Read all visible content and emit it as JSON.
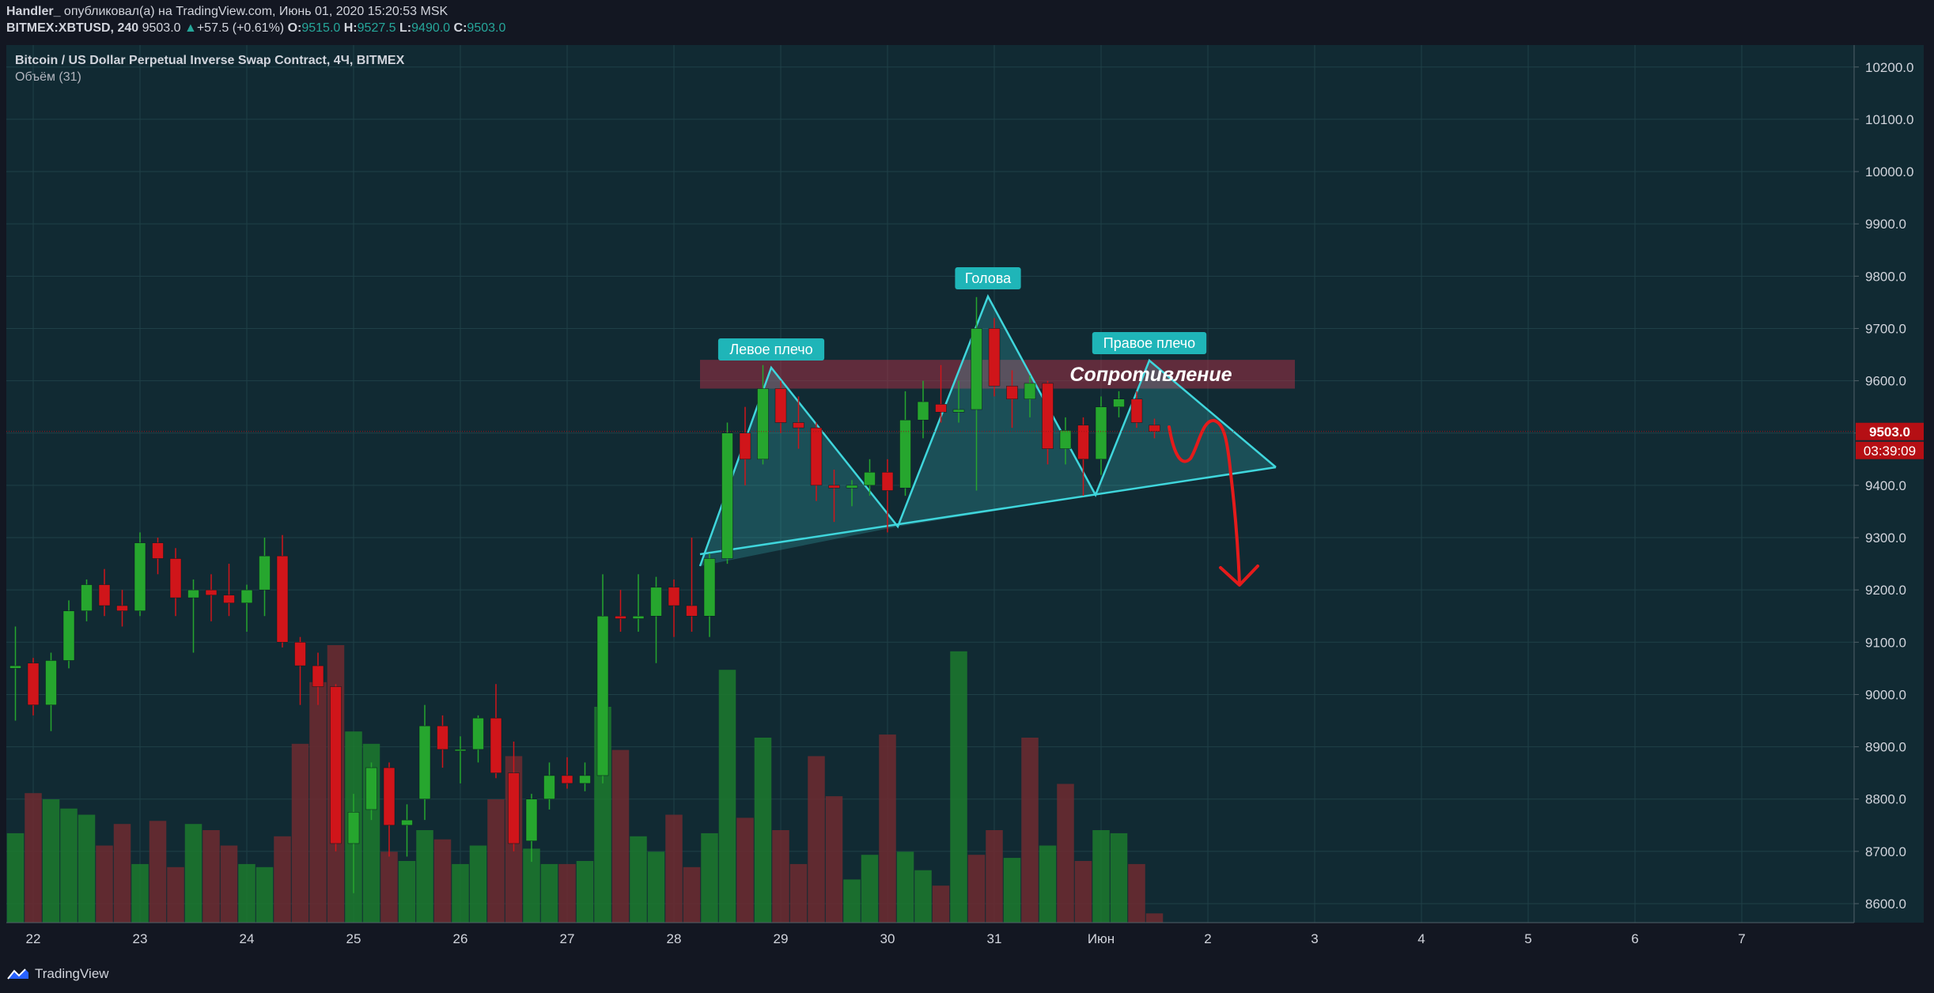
{
  "header": {
    "author": "Handler_",
    "published": " опубликовал(а) на TradingView.com, Июнь 01, 2020 15:20:53 MSK",
    "symbol": "BITMEX:XBTUSD, 240",
    "last": "9503.0",
    "change_arrow": "▲",
    "change": "+57.5 (+0.61%)",
    "o_label": "O:",
    "o": "9515.0",
    "h_label": "H:",
    "h": "9527.5",
    "l_label": "L:",
    "l": "9490.0",
    "c_label": "C:",
    "c": "9503.0"
  },
  "legend": {
    "title": "Bitcoin / US Dollar Perpetual Inverse Swap Contract, 4Ч, BITMEX",
    "volume": "Объём (31)"
  },
  "footer": {
    "brand": "TradingView",
    "logo_icon": "tradingview-logo-icon"
  },
  "colors": {
    "up": "#26a62e",
    "down": "#d0151a",
    "pattern": "#3fd6dc",
    "resistance_zone": "#b02e46",
    "price_tag": "#b50f14",
    "grid": "#1f4047"
  },
  "chart_data": {
    "type": "candlestick",
    "ylim": [
      8550,
      10250
    ],
    "y_ticks": [
      "8600.0",
      "8700.0",
      "8800.0",
      "8900.0",
      "9000.0",
      "9100.0",
      "9200.0",
      "9300.0",
      "9400.0",
      "9500.0",
      "9600.0",
      "9700.0",
      "9800.0",
      "9900.0",
      "10000.0",
      "10100.0",
      "10200.0"
    ],
    "y_tick_values": [
      8600,
      8700,
      8800,
      8900,
      9000,
      9100,
      9200,
      9300,
      9400,
      9500,
      9600,
      9700,
      9800,
      9900,
      10000,
      10100,
      10200
    ],
    "x_ticks": [
      "22",
      "23",
      "24",
      "25",
      "26",
      "27",
      "28",
      "29",
      "30",
      "31",
      "Июн",
      "2",
      "3",
      "4",
      "5",
      "6",
      "7"
    ],
    "x_tick_bar_index": [
      1,
      7,
      13,
      19,
      25,
      31,
      37,
      43,
      49,
      55,
      61,
      67,
      73,
      79,
      85,
      91,
      97
    ],
    "candles": [
      {
        "o": 9050,
        "h": 9130,
        "l": 8950,
        "c": 9055
      },
      {
        "o": 9060,
        "h": 9070,
        "l": 8960,
        "c": 8980
      },
      {
        "o": 8980,
        "h": 9080,
        "l": 8930,
        "c": 9065
      },
      {
        "o": 9065,
        "h": 9180,
        "l": 9050,
        "c": 9160
      },
      {
        "o": 9160,
        "h": 9220,
        "l": 9140,
        "c": 9210
      },
      {
        "o": 9210,
        "h": 9240,
        "l": 9150,
        "c": 9170
      },
      {
        "o": 9170,
        "h": 9200,
        "l": 9130,
        "c": 9160
      },
      {
        "o": 9160,
        "h": 9310,
        "l": 9150,
        "c": 9290
      },
      {
        "o": 9290,
        "h": 9300,
        "l": 9230,
        "c": 9260
      },
      {
        "o": 9260,
        "h": 9280,
        "l": 9150,
        "c": 9185
      },
      {
        "o": 9185,
        "h": 9220,
        "l": 9080,
        "c": 9200
      },
      {
        "o": 9200,
        "h": 9230,
        "l": 9140,
        "c": 9190
      },
      {
        "o": 9190,
        "h": 9250,
        "l": 9150,
        "c": 9175
      },
      {
        "o": 9175,
        "h": 9210,
        "l": 9120,
        "c": 9200
      },
      {
        "o": 9200,
        "h": 9300,
        "l": 9150,
        "c": 9265
      },
      {
        "o": 9265,
        "h": 9305,
        "l": 9090,
        "c": 9100
      },
      {
        "o": 9100,
        "h": 9110,
        "l": 8980,
        "c": 9055
      },
      {
        "o": 9055,
        "h": 9080,
        "l": 8980,
        "c": 9015
      },
      {
        "o": 9015,
        "h": 9020,
        "l": 8700,
        "c": 8715
      },
      {
        "o": 8715,
        "h": 8810,
        "l": 8620,
        "c": 8775
      },
      {
        "o": 8780,
        "h": 8870,
        "l": 8760,
        "c": 8860
      },
      {
        "o": 8860,
        "h": 8870,
        "l": 8690,
        "c": 8750
      },
      {
        "o": 8750,
        "h": 8790,
        "l": 8690,
        "c": 8760
      },
      {
        "o": 8800,
        "h": 8980,
        "l": 8760,
        "c": 8940
      },
      {
        "o": 8940,
        "h": 8960,
        "l": 8860,
        "c": 8895
      },
      {
        "o": 8895,
        "h": 8920,
        "l": 8830,
        "c": 8895
      },
      {
        "o": 8895,
        "h": 8960,
        "l": 8870,
        "c": 8955
      },
      {
        "o": 8955,
        "h": 9020,
        "l": 8840,
        "c": 8850
      },
      {
        "o": 8850,
        "h": 8910,
        "l": 8700,
        "c": 8715
      },
      {
        "o": 8720,
        "h": 8810,
        "l": 8680,
        "c": 8800
      },
      {
        "o": 8800,
        "h": 8870,
        "l": 8780,
        "c": 8845
      },
      {
        "o": 8845,
        "h": 8880,
        "l": 8820,
        "c": 8830
      },
      {
        "o": 8830,
        "h": 8870,
        "l": 8815,
        "c": 8845
      },
      {
        "o": 8845,
        "h": 9230,
        "l": 8830,
        "c": 9150
      },
      {
        "o": 9150,
        "h": 9200,
        "l": 9120,
        "c": 9145
      },
      {
        "o": 9145,
        "h": 9230,
        "l": 9120,
        "c": 9150
      },
      {
        "o": 9150,
        "h": 9225,
        "l": 9060,
        "c": 9205
      },
      {
        "o": 9205,
        "h": 9220,
        "l": 9110,
        "c": 9170
      },
      {
        "o": 9170,
        "h": 9300,
        "l": 9120,
        "c": 9150
      },
      {
        "o": 9150,
        "h": 9270,
        "l": 9110,
        "c": 9260
      },
      {
        "o": 9260,
        "h": 9520,
        "l": 9250,
        "c": 9500
      },
      {
        "o": 9500,
        "h": 9550,
        "l": 9400,
        "c": 9450
      },
      {
        "o": 9450,
        "h": 9630,
        "l": 9440,
        "c": 9585
      },
      {
        "o": 9585,
        "h": 9600,
        "l": 9500,
        "c": 9520
      },
      {
        "o": 9520,
        "h": 9570,
        "l": 9470,
        "c": 9510
      },
      {
        "o": 9510,
        "h": 9520,
        "l": 9370,
        "c": 9400
      },
      {
        "o": 9400,
        "h": 9430,
        "l": 9330,
        "c": 9395
      },
      {
        "o": 9395,
        "h": 9410,
        "l": 9360,
        "c": 9400
      },
      {
        "o": 9400,
        "h": 9450,
        "l": 9380,
        "c": 9425
      },
      {
        "o": 9425,
        "h": 9450,
        "l": 9310,
        "c": 9390
      },
      {
        "o": 9395,
        "h": 9580,
        "l": 9380,
        "c": 9525
      },
      {
        "o": 9525,
        "h": 9600,
        "l": 9490,
        "c": 9560
      },
      {
        "o": 9555,
        "h": 9630,
        "l": 9520,
        "c": 9540
      },
      {
        "o": 9540,
        "h": 9600,
        "l": 9520,
        "c": 9545
      },
      {
        "o": 9545,
        "h": 9760,
        "l": 9390,
        "c": 9700
      },
      {
        "o": 9700,
        "h": 9720,
        "l": 9570,
        "c": 9590
      },
      {
        "o": 9590,
        "h": 9620,
        "l": 9510,
        "c": 9565
      },
      {
        "o": 9565,
        "h": 9610,
        "l": 9530,
        "c": 9595
      },
      {
        "o": 9595,
        "h": 9600,
        "l": 9440,
        "c": 9470
      },
      {
        "o": 9470,
        "h": 9530,
        "l": 9440,
        "c": 9505
      },
      {
        "o": 9515,
        "h": 9530,
        "l": 9380,
        "c": 9450
      },
      {
        "o": 9450,
        "h": 9570,
        "l": 9420,
        "c": 9550
      },
      {
        "o": 9550,
        "h": 9580,
        "l": 9530,
        "c": 9565
      },
      {
        "o": 9565,
        "h": 9580,
        "l": 9510,
        "c": 9520
      },
      {
        "o": 9515,
        "h": 9527.5,
        "l": 9490,
        "c": 9503
      }
    ],
    "volumes": [
      145,
      210,
      200,
      185,
      175,
      125,
      160,
      95,
      165,
      90,
      160,
      150,
      125,
      95,
      90,
      140,
      290,
      390,
      450,
      310,
      290,
      115,
      100,
      150,
      135,
      95,
      125,
      200,
      270,
      120,
      95,
      95,
      100,
      350,
      280,
      140,
      115,
      175,
      90,
      145,
      410,
      170,
      300,
      150,
      95,
      270,
      205,
      70,
      110,
      305,
      115,
      85,
      60,
      440,
      110,
      150,
      105,
      300,
      125,
      225,
      100,
      150,
      145,
      95,
      15
    ],
    "volume_up": [
      true,
      false,
      true,
      true,
      true,
      false,
      false,
      true,
      false,
      false,
      true,
      false,
      false,
      true,
      true,
      false,
      false,
      false,
      false,
      true,
      true,
      false,
      true,
      true,
      false,
      true,
      true,
      false,
      false,
      true,
      true,
      false,
      true,
      true,
      false,
      true,
      true,
      false,
      false,
      true,
      true,
      false,
      true,
      false,
      false,
      false,
      false,
      true,
      true,
      false,
      true,
      true,
      false,
      true,
      false,
      false,
      true,
      false,
      true,
      false,
      false,
      true,
      true,
      false,
      false
    ],
    "current_price": "9503.0",
    "countdown": "03:39:09",
    "annotations": {
      "left_shoulder": "Левое плечо",
      "head": "Голова",
      "right_shoulder": "Правое плечо",
      "resistance": "Сопротивление"
    }
  }
}
